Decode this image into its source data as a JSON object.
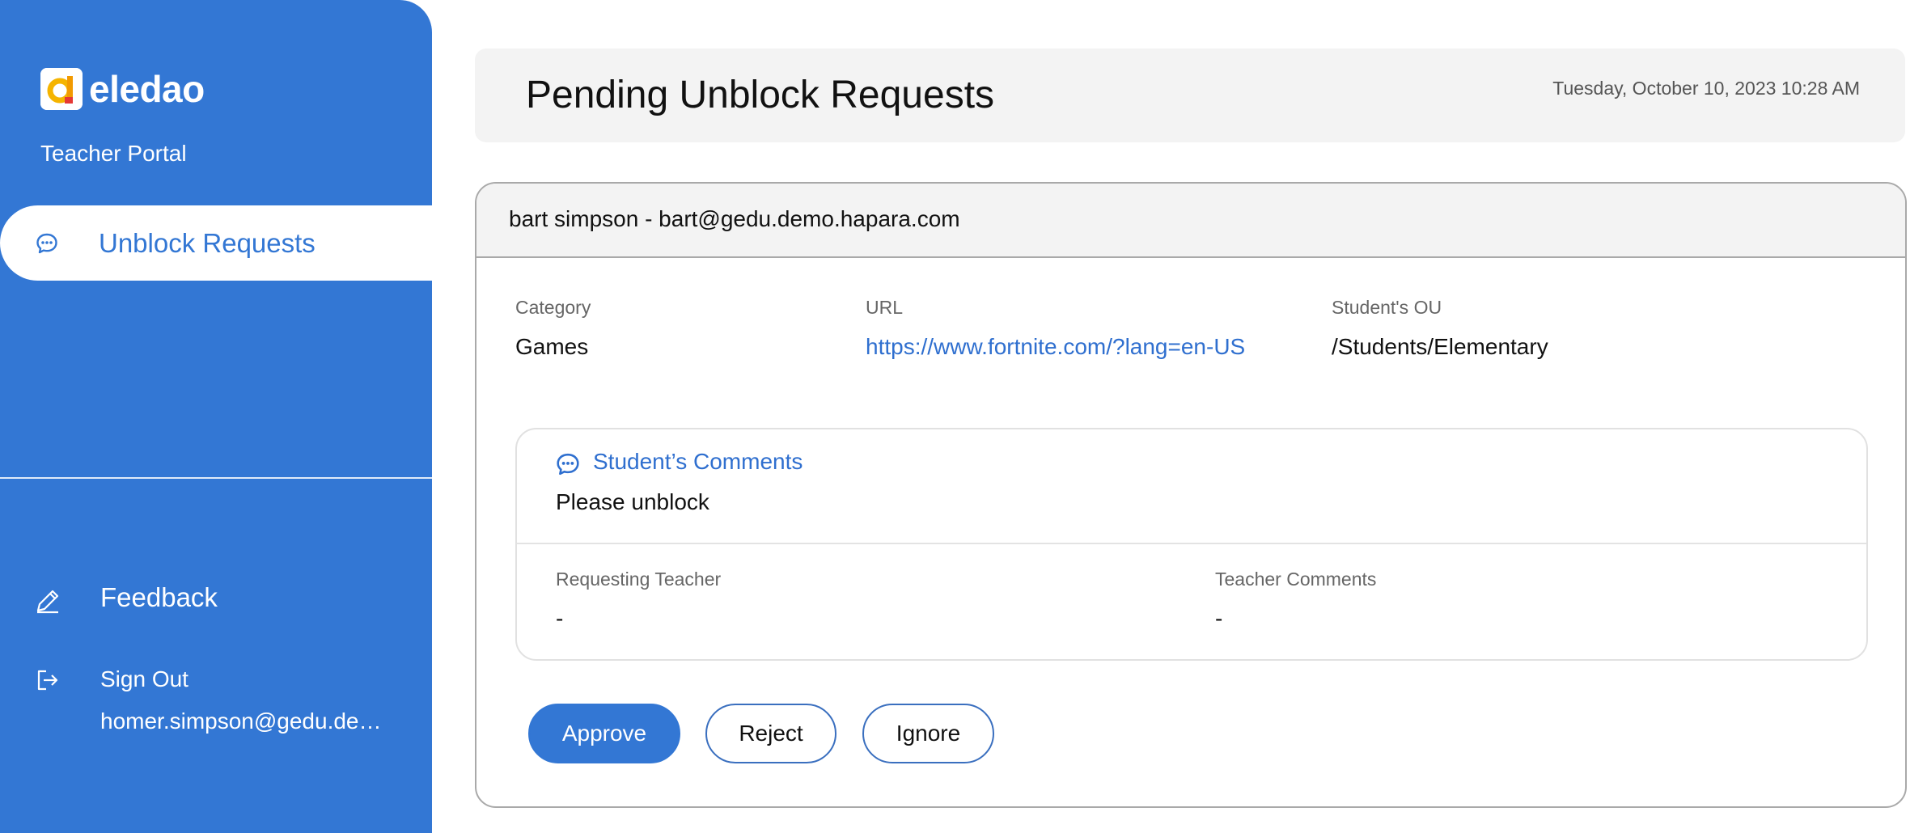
{
  "brand": {
    "name": "eledao",
    "portal": "Teacher Portal",
    "accent_color": "#3377d4",
    "logo_icon": "eledao-logo-icon"
  },
  "sidebar": {
    "active_item": {
      "label": "Unblock Requests",
      "icon": "chat-bubble-icon"
    },
    "items": [
      {
        "label": "Feedback",
        "icon": "pencil-icon"
      },
      {
        "label": "Sign Out",
        "icon": "sign-out-icon"
      }
    ],
    "user_email": "homer.simpson@gedu.demo.hapara.com"
  },
  "header": {
    "title": "Pending Unblock Requests",
    "datetime": "Tuesday, October 10, 2023 10:28 AM"
  },
  "request": {
    "student": "bart simpson - bart@gedu.demo.hapara.com",
    "fields": {
      "category_label": "Category",
      "category_value": "Games",
      "url_label": "URL",
      "url_value": "https://www.fortnite.com/?lang=en-US",
      "ou_label": "Student's OU",
      "ou_value": "/Students/Elementary"
    },
    "comments": {
      "title": "Student’s Comments",
      "icon": "chat-bubble-icon",
      "text": "Please unblock",
      "requesting_teacher_label": "Requesting Teacher",
      "requesting_teacher_value": "-",
      "teacher_comments_label": "Teacher Comments",
      "teacher_comments_value": "-"
    },
    "actions": {
      "approve": "Approve",
      "reject": "Reject",
      "ignore": "Ignore"
    }
  }
}
